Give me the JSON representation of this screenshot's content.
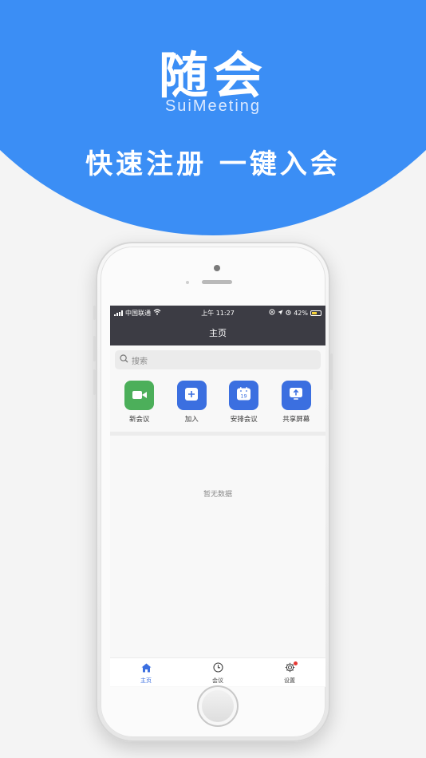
{
  "brand": {
    "title": "随会",
    "subtitle": "SuiMeeting",
    "slogan": "快速注册 一键入会",
    "accent_color": "#3b8ef5"
  },
  "status_bar": {
    "carrier": "中国联通",
    "time": "上午 11:27",
    "battery": "42%",
    "icons": [
      "signal-icon",
      "wifi-icon",
      "location-icon",
      "alarm-icon",
      "battery-icon"
    ]
  },
  "nav": {
    "title": "主页"
  },
  "search": {
    "placeholder": "搜索",
    "icon": "search-icon"
  },
  "actions": [
    {
      "label": "新会议",
      "icon": "video-camera-icon",
      "color": "#4caf5a"
    },
    {
      "label": "加入",
      "icon": "plus-icon",
      "color": "#3b6fe0"
    },
    {
      "label": "安排会议",
      "icon": "calendar-icon",
      "calendar_day": "19",
      "color": "#3b6fe0"
    },
    {
      "label": "共享屏幕",
      "icon": "share-screen-icon",
      "color": "#3b6fe0"
    }
  ],
  "empty_state": {
    "text": "暂无数据"
  },
  "tabbar": {
    "items": [
      {
        "label": "主页",
        "icon": "home-icon",
        "active": true
      },
      {
        "label": "会议",
        "icon": "clock-icon",
        "active": false
      },
      {
        "label": "设置",
        "icon": "gear-icon",
        "active": false,
        "badge": true
      }
    ],
    "active_color": "#3b6fe0",
    "badge_color": "#e53935"
  }
}
